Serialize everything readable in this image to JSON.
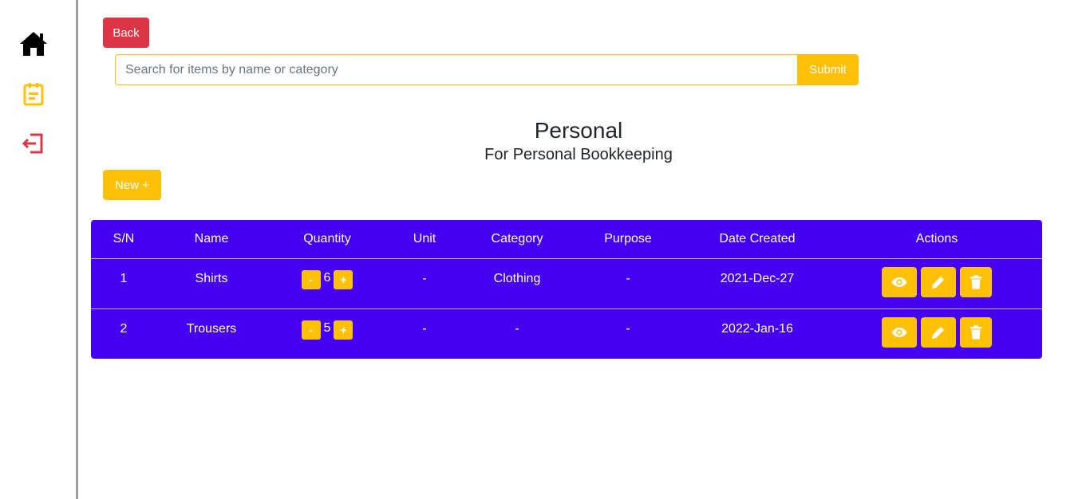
{
  "sidebar": {
    "icons": [
      "home-icon",
      "notes-icon",
      "logout-icon"
    ],
    "colors": {
      "home": "#000000",
      "notes": "#ffc107",
      "logout": "#dc3545"
    }
  },
  "toolbar": {
    "back_label": "Back",
    "new_label": "New +"
  },
  "search": {
    "placeholder": "Search for items by name or category",
    "value": "",
    "submit_label": "Submit"
  },
  "page": {
    "title": "Personal",
    "subtitle": "For Personal Bookkeeping"
  },
  "table": {
    "headers": [
      "S/N",
      "Name",
      "Quantity",
      "Unit",
      "Category",
      "Purpose",
      "Date Created",
      "Actions"
    ],
    "rows": [
      {
        "sn": "1",
        "name": "Shirts",
        "quantity": "6",
        "unit": "-",
        "category": "Clothing",
        "purpose": "-",
        "date": "2021-Dec-27"
      },
      {
        "sn": "2",
        "name": "Trousers",
        "quantity": "5",
        "unit": "-",
        "category": "-",
        "purpose": "-",
        "date": "2022-Jan-16"
      }
    ],
    "qty_minus": "-",
    "qty_plus": "+",
    "action_icons": [
      "eye-icon",
      "pencil-icon",
      "trash-icon"
    ]
  },
  "colors": {
    "table_bg": "#4600f0",
    "accent": "#ffc107",
    "danger": "#dc3545"
  }
}
